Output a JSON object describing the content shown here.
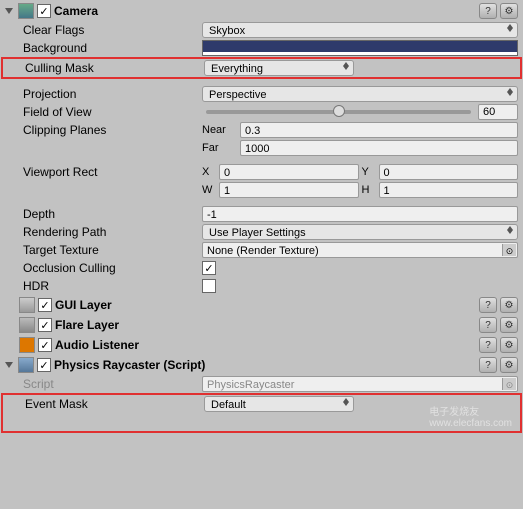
{
  "camera": {
    "title": "Camera",
    "enabled_check": "✓",
    "labels": {
      "clear_flags": "Clear Flags",
      "background": "Background",
      "culling_mask": "Culling Mask",
      "projection": "Projection",
      "field_of_view": "Field of View",
      "clipping_planes": "Clipping Planes",
      "near": "Near",
      "far": "Far",
      "viewport_rect": "Viewport Rect",
      "x": "X",
      "y": "Y",
      "w": "W",
      "h": "H",
      "depth": "Depth",
      "rendering_path": "Rendering Path",
      "target_texture": "Target Texture",
      "occlusion_culling": "Occlusion Culling",
      "hdr": "HDR"
    },
    "values": {
      "clear_flags": "Skybox",
      "culling_mask": "Everything",
      "projection": "Perspective",
      "field_of_view": "60",
      "near": "0.3",
      "far": "1000",
      "x": "0",
      "y": "0",
      "w": "1",
      "h": "1",
      "depth": "-1",
      "rendering_path": "Use Player Settings",
      "target_texture": "None (Render Texture)",
      "occlusion_check": "✓",
      "hdr_check": ""
    }
  },
  "gui_layer": {
    "title": "GUI Layer",
    "enabled_check": "✓"
  },
  "flare_layer": {
    "title": "Flare Layer",
    "enabled_check": "✓"
  },
  "audio_listener": {
    "title": "Audio Listener",
    "enabled_check": "✓"
  },
  "physics_raycaster": {
    "title": "Physics Raycaster (Script)",
    "enabled_check": "✓",
    "labels": {
      "script": "Script",
      "event_mask": "Event Mask"
    },
    "values": {
      "script": "PhysicsRaycaster",
      "event_mask": "Default"
    }
  },
  "watermark": {
    "brand": "电子发烧友",
    "site": "www.elecfans.com"
  }
}
